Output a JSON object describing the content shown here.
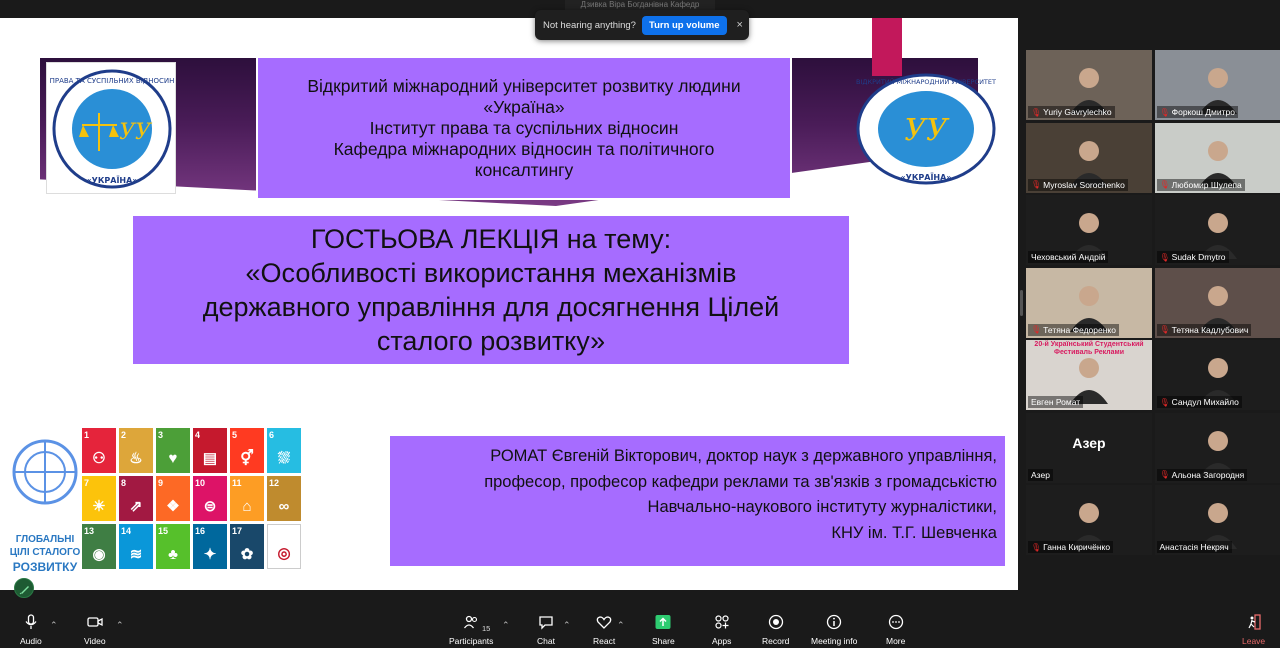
{
  "toast": {
    "message": "Not hearing anything?",
    "button_label": "Turn up volume",
    "close_glyph": "×",
    "behind_label": "Дзивка Віра Богданівна Кафедр"
  },
  "slide": {
    "university_lines": [
      "Відкритий міжнародний університет розвитку людини",
      "«Україна»",
      "Інститут права та суспільних відносин",
      "Кафедра міжнародних відносин та політичного",
      "консалтингу"
    ],
    "topic_lines": [
      "ГОСТЬОВА ЛЕКЦІЯ на тему:",
      "«Особливості використання механізмів",
      "державного управління для досягнення Цілей",
      "сталого розвитку»"
    ],
    "author_lines": [
      "РОМАТ Євгеній Вікторович, доктор наук з державного управління,",
      "професор, професор кафедри реклами та зв'язків з громадськістю",
      "Навчально-наукового інституту журналістики,",
      "КНУ ім. Т.Г. Шевченка"
    ],
    "left_logo": {
      "ring_top": "ПРАВА ТА СУСПІЛЬНИХ ВІДНОСИН",
      "ring_bottom": "«УКРАЇНА»",
      "monogram": "УУ"
    },
    "right_logo": {
      "ring_top": "ВІДКРИТИЙ МІЖНАРОДНИЙ УНІВЕРСИТЕТ",
      "ring_bottom": "«УКРАЇНА»",
      "monogram": "УУ"
    },
    "un_caption": [
      "ГЛОБАЛЬНІ",
      "ЦІЛІ СТАЛОГО",
      "РОЗВИТКУ"
    ],
    "sdg_tiles": [
      {
        "num": "1",
        "color": "#e5243b",
        "glyph": "⚇"
      },
      {
        "num": "2",
        "color": "#dda63a",
        "glyph": "♨"
      },
      {
        "num": "3",
        "color": "#4c9f38",
        "glyph": "♥"
      },
      {
        "num": "4",
        "color": "#c5192d",
        "glyph": "▤"
      },
      {
        "num": "5",
        "color": "#ff3a21",
        "glyph": "⚥"
      },
      {
        "num": "6",
        "color": "#26bde2",
        "glyph": "⛆"
      },
      {
        "num": "7",
        "color": "#fcc30b",
        "glyph": "☀"
      },
      {
        "num": "8",
        "color": "#a21942",
        "glyph": "⇗"
      },
      {
        "num": "9",
        "color": "#fd6925",
        "glyph": "❖"
      },
      {
        "num": "10",
        "color": "#dd1367",
        "glyph": "⊜"
      },
      {
        "num": "11",
        "color": "#fd9d24",
        "glyph": "⌂"
      },
      {
        "num": "12",
        "color": "#bf8b2e",
        "glyph": "∞"
      },
      {
        "num": "13",
        "color": "#3f7e44",
        "glyph": "◉"
      },
      {
        "num": "14",
        "color": "#0a97d9",
        "glyph": "≋"
      },
      {
        "num": "15",
        "color": "#56c02b",
        "glyph": "♣"
      },
      {
        "num": "16",
        "color": "#00689d",
        "glyph": "✦"
      },
      {
        "num": "17",
        "color": "#19486a",
        "glyph": "✿"
      },
      {
        "num": "",
        "color": "#ffffff",
        "glyph": "◎"
      }
    ]
  },
  "participants": [
    {
      "name": "Yuriy Gavrylechko",
      "muted": true,
      "bg": "#6d6258"
    },
    {
      "name": "Форкош Дмитро",
      "muted": true,
      "bg": "#8a8f96"
    },
    {
      "name": "Myroslav Sorochenko",
      "muted": true,
      "bg": "#4a4036"
    },
    {
      "name": "Любомир Шулепа",
      "muted": true,
      "bg": "#c9ccc8"
    },
    {
      "name": "Чеховський Андрій",
      "muted": false,
      "bg": "#1d1d1d"
    },
    {
      "name": "Sudak Dmytro",
      "muted": true,
      "bg": "#1d1d1d"
    },
    {
      "name": "Тетяна Федоренко",
      "muted": true,
      "bg": "#c7b8a4"
    },
    {
      "name": "Тетяна Кадлубович",
      "muted": true,
      "bg": "#5e4f4a"
    },
    {
      "name": "Евген Ромат",
      "muted": false,
      "bg": "#d9d4cf",
      "banner": "20-й Український Студентський Фестиваль Реклами"
    },
    {
      "name": "Сандул Михайло",
      "muted": true,
      "bg": "#1d1d1d"
    },
    {
      "name": "Азер",
      "muted": false,
      "bg": "#1d1d1d",
      "text_only": true
    },
    {
      "name": "Альона Загородня",
      "muted": true,
      "bg": "#1d1d1d"
    },
    {
      "name": "Ганна Киричёнко",
      "muted": true,
      "bg": "#1d1d1d"
    },
    {
      "name": "Анастасія Некряч",
      "muted": false,
      "bg": "#1d1d1d"
    }
  ],
  "toolbar": {
    "audio": "Audio",
    "video": "Video",
    "participants": "Participants",
    "participants_count": "15",
    "chat": "Chat",
    "react": "React",
    "share": "Share",
    "apps": "Apps",
    "record": "Record",
    "meeting_info": "Meeting info",
    "more": "More",
    "leave": "Leave",
    "share_color": "#2ecc71",
    "leave_color": "#e86a6a"
  }
}
